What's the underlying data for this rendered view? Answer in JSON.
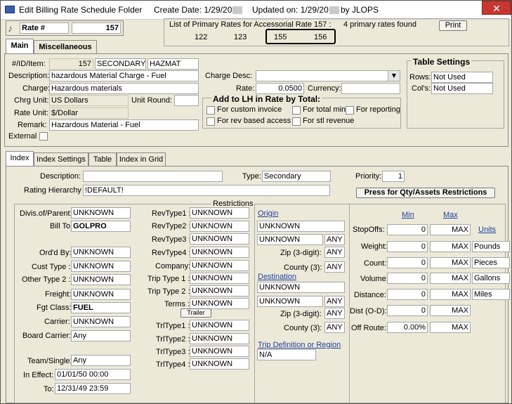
{
  "title": {
    "app": "Edit Billing Rate Schedule Folder",
    "create": "Create Date: 1/29/20",
    "updated": "Updated on: 1/29/20",
    "by": "by  JLOPS",
    "close": "✕"
  },
  "rate": {
    "label": "Rate #",
    "value": "157"
  },
  "primary": {
    "header": "List of Primary Rates for Accessorial Rate 157 :",
    "found": "4 primary rates found",
    "print": "Print",
    "rates": [
      "122",
      "123",
      "155",
      "156"
    ]
  },
  "tabs_top": [
    "Main",
    "Miscellaneous"
  ],
  "main": {
    "id_label": "#/ID/Item:",
    "id_num": "157",
    "id_id": "SECONDARY",
    "id_item": "HAZMAT",
    "desc_label": "Description:",
    "desc": "hazardous Material Charge - Fuel",
    "charge_label": "Charge:",
    "charge": "Hazardous materials",
    "chrg_unit_label": "Chrg Unit:",
    "chrg_unit": "US Dollars",
    "unit_round_label": "Unit Round:",
    "unit_round": "",
    "rate_unit_label": "Rate Unit:",
    "rate_unit": "$/Dollar",
    "remark_label": "Remark:",
    "remark": "Hazardous Material - Fuel",
    "external_label": "External",
    "charge_desc_label": "Charge Desc:",
    "charge_desc": "",
    "rate_label": "Rate:",
    "rate": "0.0500",
    "currency_label": "Currency:",
    "currency": ""
  },
  "add_lh": {
    "title": "Add to LH in Rate by Total:",
    "opts": [
      "For custom invoice",
      "For total min",
      "For reporting",
      "For rev based access",
      "For stl revenue"
    ]
  },
  "table_settings": {
    "title": "Table Settings",
    "rows_label": "Rows:",
    "rows": "Not Used",
    "cols_label": "Col's:",
    "cols": "Not Used"
  },
  "tabs_bottom": [
    "Index",
    "Index Settings",
    "Table",
    "Index in Grid"
  ],
  "index": {
    "desc_label": "Description:",
    "desc": "",
    "type_label": "Type:",
    "type": "Secondary",
    "priority_label": "Priority:",
    "priority": "1",
    "rating_label": "Rating Hierarchy",
    "rating": "!DEFAULT!",
    "press_btn": "Press for Qty/Assets Restrictions",
    "restrictions": "Restrictions"
  },
  "col1": [
    {
      "label": "Divis.of/Parent:",
      "value": "UNKNOWN"
    },
    {
      "label": "Bill To:",
      "value": "GOLPRO"
    },
    {
      "label": "Ord'd By:",
      "value": "UNKNOWN"
    },
    {
      "label": "Cust Type :",
      "value": "UNKNOWN"
    },
    {
      "label": "Other Type 2 :",
      "value": "UNKNOWN"
    },
    {
      "label": "Freight:",
      "value": "UNKNOWN"
    },
    {
      "label": "Fgt Class:",
      "value": "FUEL"
    },
    {
      "label": "Carrier:",
      "value": "UNKNOWN"
    },
    {
      "label": "Board Carrier:",
      "value": "Any"
    },
    {
      "label": "Team/Single:",
      "value": "Any"
    },
    {
      "label": "In Effect:",
      "value": "01/01/50 00:00"
    },
    {
      "label": "To:",
      "value": "12/31/49 23:59"
    }
  ],
  "col2": [
    {
      "label": "RevType1 :",
      "value": "UNKNOWN"
    },
    {
      "label": "RevType2 :",
      "value": "UNKNOWN"
    },
    {
      "label": "RevType3 :",
      "value": "UNKNOWN"
    },
    {
      "label": "RevType4 :",
      "value": "UNKNOWN"
    },
    {
      "label": "Company:",
      "value": "UNKNOWN"
    },
    {
      "label": "Trip Type 1 :",
      "value": "UNKNOWN"
    },
    {
      "label": "Trip Type 2 :",
      "value": "UNKNOWN"
    },
    {
      "label": "Terms :",
      "value": "UNKNOWN"
    }
  ],
  "trailer_btn": "Trailer",
  "col2b": [
    {
      "label": "TrlType1 :",
      "value": "UNKNOWN"
    },
    {
      "label": "TrlType2 :",
      "value": "UNKNOWN"
    },
    {
      "label": "TrlType3 :",
      "value": "UNKNOWN"
    },
    {
      "label": "TrlType4 :",
      "value": "UNKNOWN"
    }
  ],
  "col3": {
    "origin": "Origin",
    "origin_val": "UNKNOWN",
    "origin2": "UNKNOWN",
    "origin_any": "ANY",
    "zip_label": "Zip (3-digit):",
    "zip": "ANY",
    "county_label": "County (3):",
    "county": "ANY",
    "dest": "Destination",
    "dest_val": "UNKNOWN",
    "dest2": "UNKNOWN",
    "dest_any": "ANY",
    "dzip": "ANY",
    "dcounty": "ANY",
    "trip_def": "Trip Definition or Region",
    "trip_val": "N/A"
  },
  "col4": {
    "min": "Min",
    "max": "Max",
    "units": "Units",
    "rows": [
      {
        "label": "StopOffs:",
        "min": "0",
        "max": "MAX",
        "unit": ""
      },
      {
        "label": "Weight:",
        "min": "0",
        "max": "MAX",
        "unit": "Pounds"
      },
      {
        "label": "Count:",
        "min": "0",
        "max": "MAX",
        "unit": "Pieces"
      },
      {
        "label": "Volume:",
        "min": "0",
        "max": "MAX",
        "unit": "Gallons"
      },
      {
        "label": "Distance:",
        "min": "0",
        "max": "MAX",
        "unit": "Miles"
      },
      {
        "label": "Dist (O-D):",
        "min": "0",
        "max": "MAX",
        "unit": ""
      },
      {
        "label": "Off Route:",
        "min": "0.00%",
        "max": "MAX",
        "unit": ""
      }
    ]
  }
}
